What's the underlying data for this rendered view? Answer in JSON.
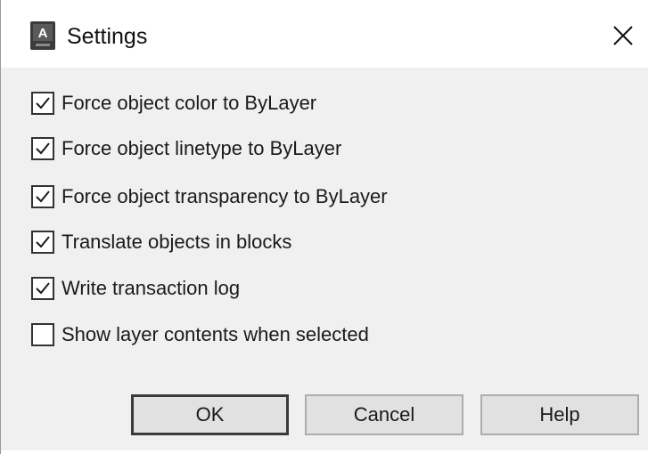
{
  "window": {
    "title": "Settings",
    "app_icon": "autocad-app-icon",
    "app_icon_letter": "A",
    "close_icon": "close-icon"
  },
  "options": [
    {
      "label": "Force object color to ByLayer",
      "checked": true
    },
    {
      "label": "Force object linetype to ByLayer",
      "checked": true
    },
    {
      "label": "Force object transparency to ByLayer",
      "checked": true
    },
    {
      "label": "Translate objects in blocks",
      "checked": true
    },
    {
      "label": "Write transaction log",
      "checked": true
    },
    {
      "label": "Show layer contents when selected",
      "checked": false
    }
  ],
  "buttons": {
    "ok": "OK",
    "cancel": "Cancel",
    "help": "Help"
  },
  "colors": {
    "dialog_bg": "#f0f0f0",
    "titlebar_bg": "#ffffff",
    "button_bg": "#e1e1e1"
  }
}
